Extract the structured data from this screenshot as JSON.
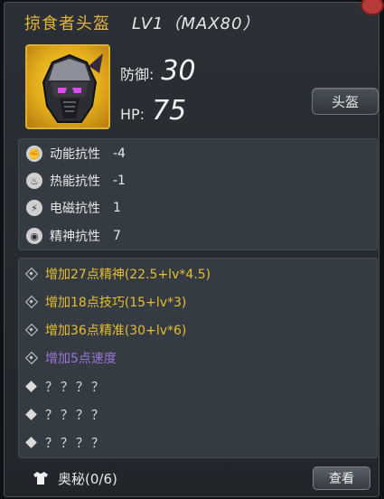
{
  "item": {
    "name": "掠食者头盔",
    "level": "LV1（MAX80）"
  },
  "stats": {
    "defense_label": "防御:",
    "defense_value": "30",
    "hp_label": "HP:",
    "hp_value": "75"
  },
  "slot_button": "头盔",
  "resistances": [
    {
      "label": "动能抗性",
      "value": "-4",
      "icon": "kinetic-icon"
    },
    {
      "label": "热能抗性",
      "value": "-1",
      "icon": "thermal-icon"
    },
    {
      "label": "电磁抗性",
      "value": "1",
      "icon": "em-icon"
    },
    {
      "label": "精神抗性",
      "value": "7",
      "icon": "psychic-icon"
    }
  ],
  "bonuses": [
    {
      "text": "增加27点精神(22.5+lv*4.5)",
      "color": "#e6be2e"
    },
    {
      "text": "增加18点技巧(15+lv*3)",
      "color": "#e6be2e"
    },
    {
      "text": "增加36点精准(30+lv*6)",
      "color": "#e6be2e"
    },
    {
      "text": "增加5点速度",
      "color": "#9b74d8"
    },
    {
      "text": "？？？？"
    },
    {
      "text": "？？？？"
    },
    {
      "text": "？？？？"
    }
  ],
  "footer": {
    "label": "奥秘(0/6)",
    "view_button": "查看"
  }
}
